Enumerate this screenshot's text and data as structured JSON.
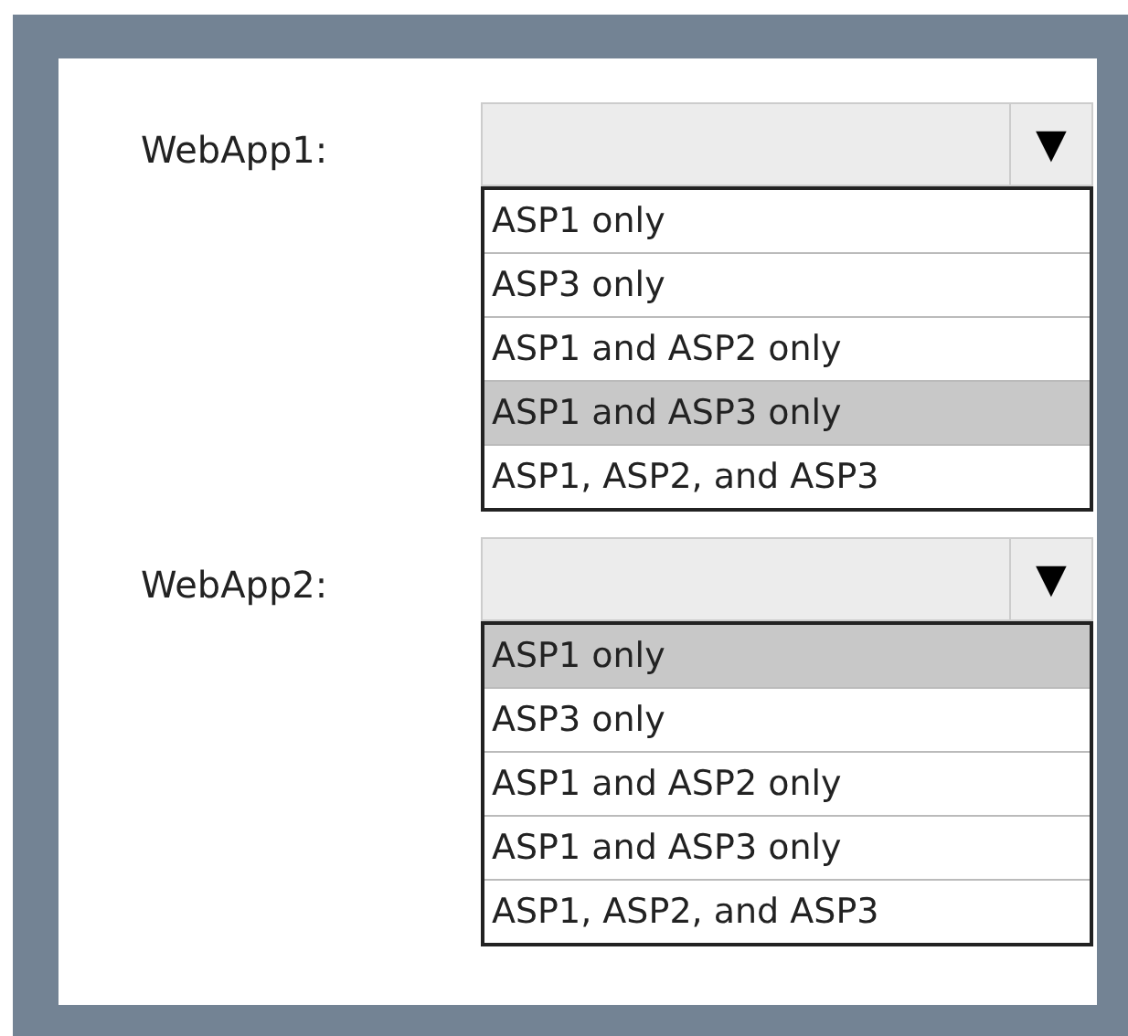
{
  "dropdowns": [
    {
      "label": "WebApp1:",
      "arrow": "▼",
      "options": [
        {
          "label": "ASP1 only",
          "selected": false
        },
        {
          "label": "ASP3 only",
          "selected": false
        },
        {
          "label": "ASP1 and ASP2 only",
          "selected": false
        },
        {
          "label": "ASP1 and ASP3 only",
          "selected": true
        },
        {
          "label": "ASP1, ASP2, and ASP3",
          "selected": false
        }
      ]
    },
    {
      "label": "WebApp2:",
      "arrow": "▼",
      "options": [
        {
          "label": "ASP1 only",
          "selected": true
        },
        {
          "label": "ASP3 only",
          "selected": false
        },
        {
          "label": "ASP1 and ASP2 only",
          "selected": false
        },
        {
          "label": "ASP1 and ASP3 only",
          "selected": false
        },
        {
          "label": "ASP1, ASP2, and ASP3",
          "selected": false
        }
      ]
    }
  ]
}
